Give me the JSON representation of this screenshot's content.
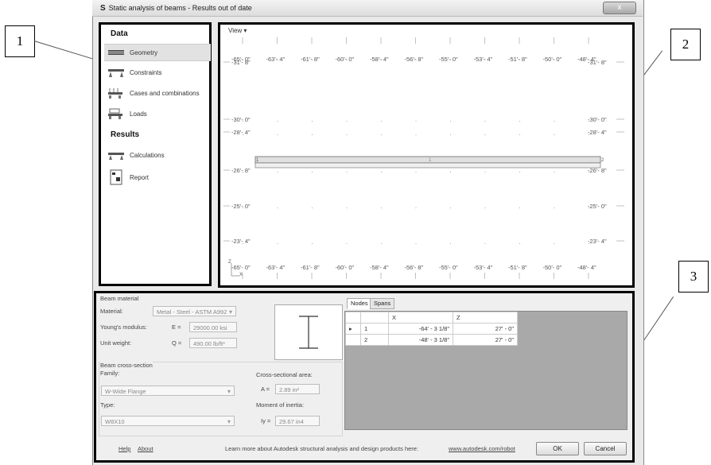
{
  "window": {
    "title": "Static analysis of beams - Results out of date",
    "app_icon": "S",
    "close": "x"
  },
  "callouts": [
    "1",
    "2",
    "3"
  ],
  "sidebar": {
    "data_header": "Data",
    "items": [
      {
        "label": "Geometry",
        "icon": "geometry-icon"
      },
      {
        "label": "Constraints",
        "icon": "constraints-icon"
      },
      {
        "label": "Cases and combinations",
        "icon": "cases-icon"
      },
      {
        "label": "Loads",
        "icon": "loads-icon"
      }
    ],
    "results_header": "Results",
    "results_items": [
      {
        "label": "Calculations",
        "icon": "calculations-icon"
      },
      {
        "label": "Report",
        "icon": "report-icon"
      }
    ]
  },
  "view": {
    "menu": "View ▾",
    "top_labels": [
      "-65'- 0\"",
      "-63'- 4\"",
      "-61'- 8\"",
      "-60'- 0\"",
      "-58'- 4\"",
      "-56'- 8\"",
      "-55'- 0\"",
      "-53'- 4\"",
      "-51'- 8\"",
      "-50'- 0\"",
      "-48'- 4\""
    ],
    "bottom_labels": [
      "-65'- 0\"",
      "-63'- 4\"",
      "-61'- 8\"",
      "-60'- 0\"",
      "-58'- 4\"",
      "-56'- 8\"",
      "-55'- 0\"",
      "-53'- 4\"",
      "-51'- 8\"",
      "-50'- 0\"",
      "-48'- 4\""
    ],
    "left_labels": [
      "-31'- 8\"",
      "-30'- 0\"",
      "-28'- 4\"",
      "-26'- 8\"",
      "-25'- 0\"",
      "-23'- 4\""
    ],
    "right_labels": [
      "-31'- 8\"",
      "-30'- 0\"",
      "-28'- 4\"",
      "-26'- 8\"",
      "-25'- 0\"",
      "-23'- 4\""
    ],
    "node_labels": [
      "1",
      "2"
    ],
    "span_label": "1",
    "axis_z": "Z",
    "axis_x": "X"
  },
  "material": {
    "group": "Beam material",
    "material_label": "Material:",
    "material_value": "Metal - Steel - ASTM A992",
    "youngs_label": "Young's modulus:",
    "youngs_sym": "E =",
    "youngs_value": "29000.00 ksi",
    "weight_label": "Unit weight:",
    "weight_sym": "Q =",
    "weight_value": "490.00 lb/ft³"
  },
  "section": {
    "group": "Beam cross-section",
    "family_label": "Family:",
    "family_value": "W-Wide Flange",
    "type_label": "Type:",
    "type_value": "W8X10",
    "area_label": "Cross-sectional area:",
    "area_sym": "A =",
    "area_value": "2.89 in²",
    "inertia_label": "Moment of inertia:",
    "inertia_sym": "Iy =",
    "inertia_value": "29.67 in4"
  },
  "nodes": {
    "tabs": [
      "Nodes",
      "Spans"
    ],
    "columns": [
      "X",
      "Z"
    ],
    "rows": [
      {
        "marker": "▸",
        "id": "1",
        "x": "-64' - 3 1/8\"",
        "z": "27' - 0\""
      },
      {
        "marker": "",
        "id": "2",
        "x": "-48' - 3 1/8\"",
        "z": "27' - 0\""
      }
    ]
  },
  "footer": {
    "help": "Help",
    "about": "About",
    "learn": "Learn more about Autodesk structural analysis and design products here:",
    "url": "www.autodesk.com/robot",
    "ok": "OK",
    "cancel": "Cancel"
  }
}
